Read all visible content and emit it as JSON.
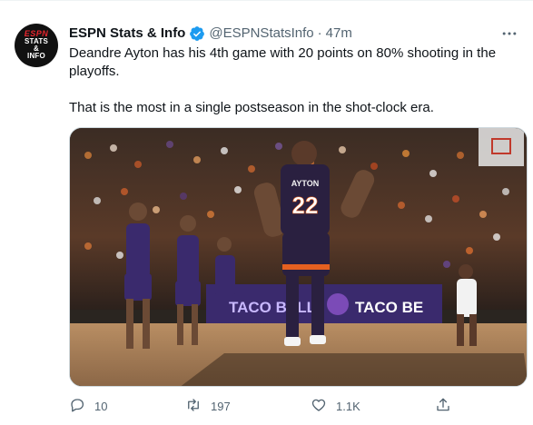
{
  "account": {
    "avatar_lines": [
      "ESPN",
      "STATS",
      "&",
      "INFO"
    ],
    "display_name": "ESPN Stats & Info",
    "handle": "@ESPNStatsInfo",
    "separator": "·",
    "time": "47m",
    "verified": true
  },
  "tweet": {
    "paragraphs": [
      "Deandre Ayton has his 4th game with 20 points on 80% shooting in the playoffs.",
      "That is the most in a single postseason in the shot-clock era."
    ]
  },
  "media": {
    "jersey_name": "AYTON",
    "jersey_number": "22",
    "banner_text": "TACO BELL",
    "banner_text_2": "TACO BE"
  },
  "actions": {
    "replies": "10",
    "retweets": "197",
    "likes": "1.1K"
  },
  "colors": {
    "verified_blue": "#1d9bf0",
    "suns_purple": "#3a2a6d",
    "suns_orange": "#e56020",
    "muted_text": "#536471"
  },
  "icons": [
    "more-icon",
    "verified-icon",
    "reply-icon",
    "retweet-icon",
    "like-icon",
    "share-icon"
  ]
}
